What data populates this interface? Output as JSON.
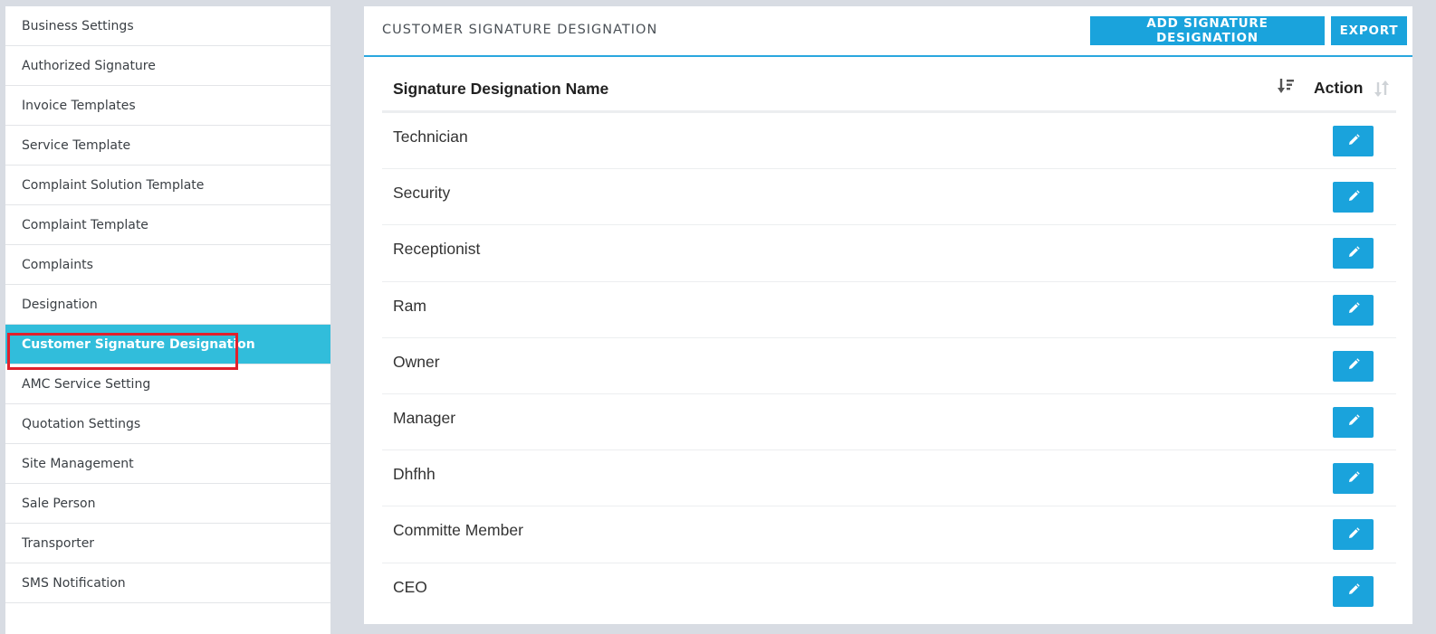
{
  "sidebar": {
    "items": [
      {
        "label": "Business Settings"
      },
      {
        "label": "Authorized Signature"
      },
      {
        "label": "Invoice Templates"
      },
      {
        "label": "Service Template"
      },
      {
        "label": "Complaint Solution Template"
      },
      {
        "label": "Complaint Template"
      },
      {
        "label": "Complaints"
      },
      {
        "label": "Designation"
      },
      {
        "label": "Customer Signature Designation",
        "active": true
      },
      {
        "label": "AMC Service Setting"
      },
      {
        "label": "Quotation Settings"
      },
      {
        "label": "Site Management"
      },
      {
        "label": "Sale Person"
      },
      {
        "label": "Transporter"
      },
      {
        "label": "SMS Notification"
      }
    ]
  },
  "panel": {
    "title": "CUSTOMER SIGNATURE DESIGNATION",
    "add_button_label": "ADD SIGNATURE DESIGNATION",
    "export_button_label": "EXPORT"
  },
  "table": {
    "columns": [
      "Signature Designation Name",
      "Action"
    ],
    "rows": [
      {
        "name": "Technician"
      },
      {
        "name": "Security"
      },
      {
        "name": "Receptionist"
      },
      {
        "name": "Ram"
      },
      {
        "name": "Owner"
      },
      {
        "name": "Manager"
      },
      {
        "name": "Dhfhh"
      },
      {
        "name": "Committe Member"
      },
      {
        "name": "CEO"
      }
    ],
    "icons": {
      "sort_name": "sort-desc-icon",
      "sort_action": "sort-icon",
      "edit": "pencil-icon"
    }
  },
  "colors": {
    "accent": "#1aa3dc",
    "active_sidebar": "#31bddb",
    "highlight": "#e0202c"
  }
}
